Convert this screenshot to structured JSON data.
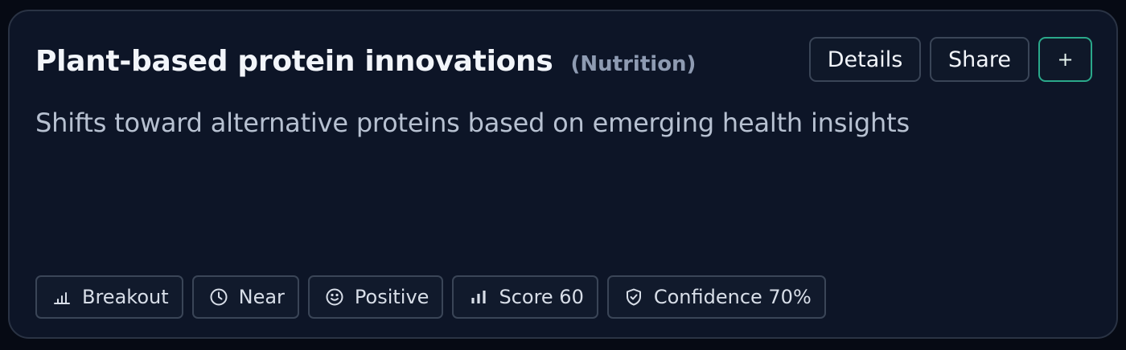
{
  "card": {
    "title": "Plant-based protein innovations",
    "category": "(Nutrition)",
    "description": "Shifts toward alternative proteins based on emerging health insights"
  },
  "actions": {
    "details_label": "Details",
    "share_label": "Share",
    "add_label": "+"
  },
  "tags": [
    {
      "icon": "trend-bars-icon",
      "label": "Breakout"
    },
    {
      "icon": "clock-icon",
      "label": "Near"
    },
    {
      "icon": "smiley-icon",
      "label": "Positive"
    },
    {
      "icon": "signal-bars-icon",
      "label": "Score 60"
    },
    {
      "icon": "shield-check-icon",
      "label": "Confidence 70%"
    }
  ],
  "colors": {
    "background": "#060a14",
    "card": "#0d1527",
    "border": "#2a3344",
    "accent": "#2aa88a"
  }
}
